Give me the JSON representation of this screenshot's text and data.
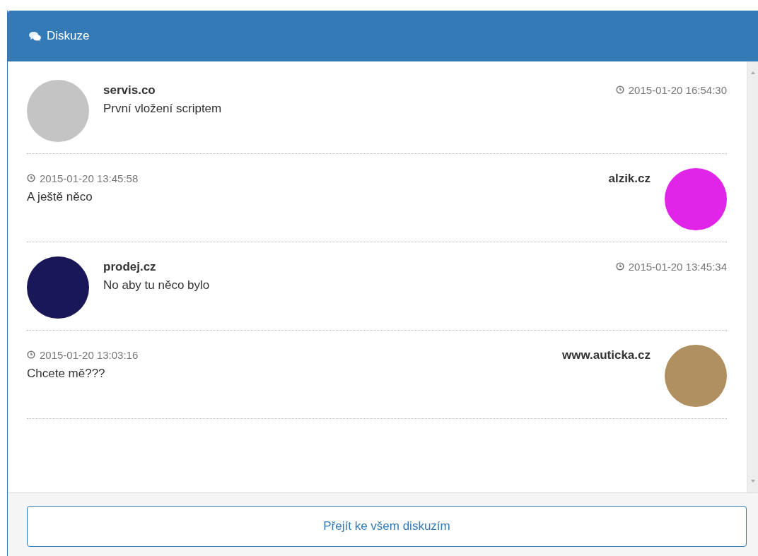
{
  "panel": {
    "title": "Diskuze"
  },
  "messages": [
    {
      "kind": "left",
      "author": "servis.co",
      "time": "2015-01-20 16:54:30",
      "text": "První vložení scriptem",
      "color": "#c4c4c4"
    },
    {
      "kind": "right",
      "author": "alzik.cz",
      "time": "2015-01-20 13:45:58",
      "text": "A ještě něco",
      "color": "#e024e8"
    },
    {
      "kind": "left",
      "author": "prodej.cz",
      "time": "2015-01-20 13:45:34",
      "text": "No aby tu něco bylo",
      "color": "#1a1758"
    },
    {
      "kind": "right",
      "author": "www.auticka.cz",
      "time": "2015-01-20 13:03:16",
      "text": "Chcete mě???",
      "color": "#b08f60"
    }
  ],
  "footer": {
    "button": "Přejít ke všem diskuzím"
  }
}
